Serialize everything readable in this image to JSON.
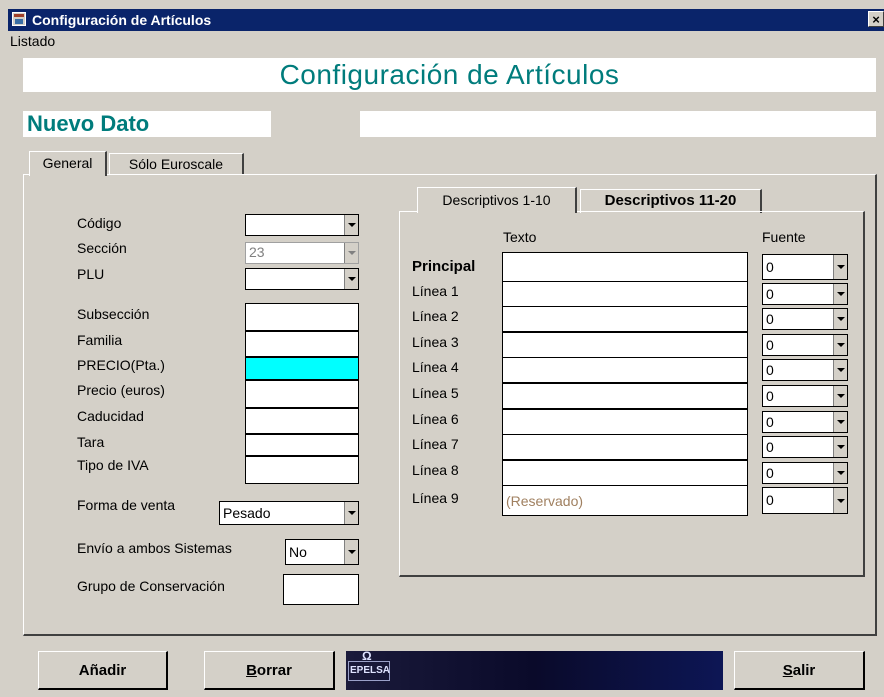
{
  "window": {
    "title": "Configuración de Artículos",
    "close_glyph": "×"
  },
  "menu": {
    "listado": "Listado"
  },
  "header": {
    "title": "Configuración de Artículos",
    "nuevo_dato": "Nuevo Dato",
    "nuevo_value": ""
  },
  "tabs": {
    "general": "General",
    "solo_euroscale": "Sólo Euroscale"
  },
  "form": {
    "codigo_label": "Código",
    "codigo_value": "",
    "seccion_label": "Sección",
    "seccion_value": "23",
    "plu_label": "PLU",
    "plu_value": "",
    "subseccion_label": "Subsección",
    "familia_label": "Familia",
    "precio_pta_label": "PRECIO(Pta.)",
    "precio_euros_label": "Precio (euros)",
    "caducidad_label": "Caducidad",
    "tara_label": "Tara",
    "tipo_iva_label": "Tipo de IVA",
    "forma_venta_label": "Forma de venta",
    "forma_venta_value": "Pesado",
    "envio_label": "Envío a ambos Sistemas",
    "envio_value": "No",
    "grupo_label": "Grupo de Conservación",
    "highlight_color": "#00ffff"
  },
  "desc_tabs": {
    "tab1": "Descriptivos 1-10",
    "tab2": "Descriptivos 11-20"
  },
  "desc": {
    "texto_header": "Texto",
    "fuente_header": "Fuente",
    "rows": [
      {
        "label": "Principal",
        "texto": "",
        "fuente": "0"
      },
      {
        "label": "Línea 1",
        "texto": "",
        "fuente": "0"
      },
      {
        "label": "Línea 2",
        "texto": "",
        "fuente": "0"
      },
      {
        "label": "Línea 3",
        "texto": "",
        "fuente": "0"
      },
      {
        "label": "Línea 4",
        "texto": "",
        "fuente": "0"
      },
      {
        "label": "Línea 5",
        "texto": "",
        "fuente": "0"
      },
      {
        "label": "Línea 6",
        "texto": "",
        "fuente": "0"
      },
      {
        "label": "Línea 7",
        "texto": "",
        "fuente": "0"
      },
      {
        "label": "Línea 8",
        "texto": "",
        "fuente": "0"
      },
      {
        "label": "Línea 9",
        "texto": "(Reservado)",
        "fuente": "0"
      }
    ]
  },
  "buttons": {
    "anadir": "Añadir",
    "borrar_u": "B",
    "borrar_rest": "orrar",
    "salir_u": "S",
    "salir_rest": "alir"
  },
  "logo": {
    "text": "EPELSA",
    "symbol": "Ω"
  }
}
